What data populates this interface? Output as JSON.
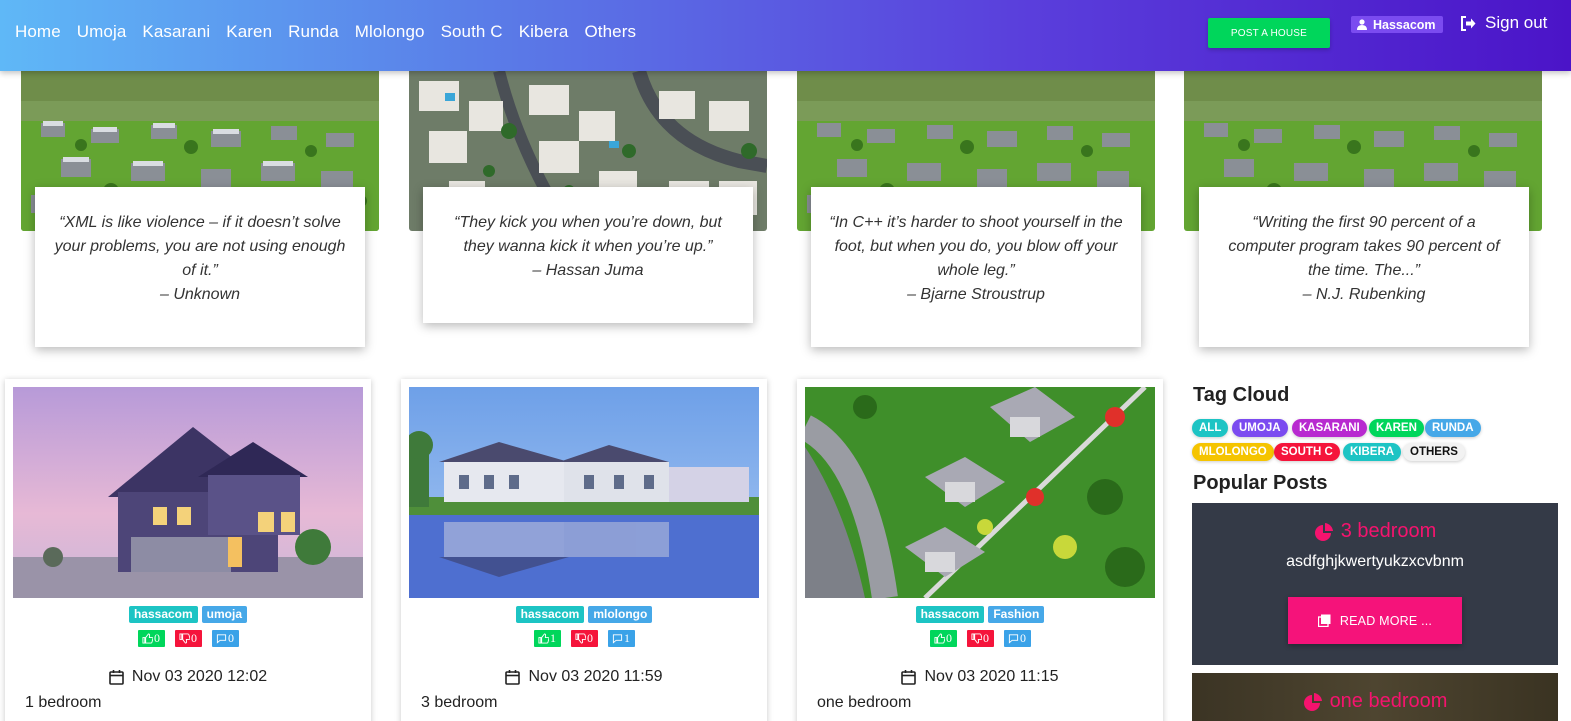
{
  "nav": {
    "links": [
      "Home",
      "Umoja",
      "Kasarani",
      "Karen",
      "Runda",
      "Mlolongo",
      "South C",
      "Kibera",
      "Others"
    ],
    "post_button": "POST A HOUSE",
    "user": "Hassacom",
    "signout": "Sign out"
  },
  "testimonials": [
    {
      "quote": "“XML is like violence – if it doesn’t solve your problems, you are not using enough of it.”",
      "author": "– Unknown"
    },
    {
      "quote": "“They kick you when you’re down, but they wanna kick it when you’re up.”",
      "author": "– Hassan Juma"
    },
    {
      "quote": "“In C++ it’s harder to shoot yourself in the foot, but when you do, you blow off your whole leg.”",
      "author": "– Bjarne Stroustrup"
    },
    {
      "quote": "“Writing the first 90 percent of a computer program takes 90 percent of the time. The...”",
      "author": "– N.J. Rubenking"
    }
  ],
  "posts": [
    {
      "tags": [
        "hassacom",
        "umoja"
      ],
      "likes": "0",
      "dislikes": "0",
      "comments": "0",
      "date": "Nov 03 2020 12:02",
      "title": "1 bedroom"
    },
    {
      "tags": [
        "hassacom",
        "mlolongo"
      ],
      "likes": "1",
      "dislikes": "0",
      "comments": "1",
      "date": "Nov 03 2020 11:59",
      "title": "3 bedroom"
    },
    {
      "tags": [
        "hassacom",
        "Fashion"
      ],
      "likes": "0",
      "dislikes": "0",
      "comments": "0",
      "date": "Nov 03 2020 11:15",
      "title": "one bedroom"
    }
  ],
  "sidebar": {
    "tag_cloud_title": "Tag Cloud",
    "tags": [
      {
        "label": "ALL",
        "color": "#1dc4c4"
      },
      {
        "label": "UMOJA",
        "color": "#7b4bf0"
      },
      {
        "label": "KASARANI",
        "color": "#b82ad0"
      },
      {
        "label": "KAREN",
        "color": "#00d65b"
      },
      {
        "label": "RUNDA",
        "color": "#46a8e8"
      },
      {
        "label": "MLOLONGO",
        "color": "#f5c400"
      },
      {
        "label": "SOUTH C",
        "color": "#f5143b"
      },
      {
        "label": "KIBERA",
        "color": "#1dc4c4"
      },
      {
        "label": "OTHERS",
        "color": "#f2f2f2"
      }
    ],
    "popular_title": "Popular Posts",
    "popular": [
      {
        "title": "3 bedroom",
        "text": "asdfghjkwertyukzxcvbnm",
        "button": "READ MORE ..."
      },
      {
        "title": "one bedroom"
      }
    ]
  },
  "colors": {
    "accent_pink": "#f5136e",
    "green": "#00d65b",
    "red": "#f5143b",
    "blue": "#3aa2e8",
    "nav_start": "#5fb8f7",
    "nav_end": "#4b14c8"
  }
}
